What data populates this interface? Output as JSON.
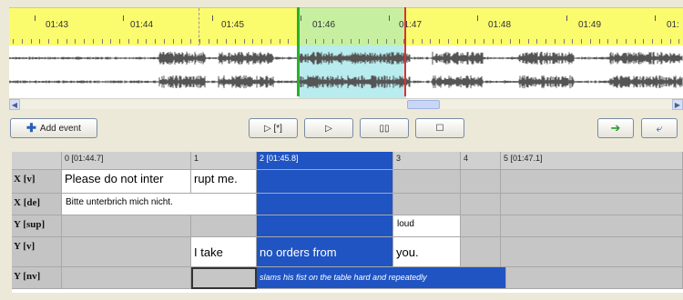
{
  "timeline": {
    "ticks": [
      "01:43",
      "01:44",
      "01:45",
      "01:46",
      "01:47",
      "01:48",
      "01:49",
      "01:"
    ]
  },
  "toolbar": {
    "add_event_label": "Add event",
    "play_selection_label": "▷ [*]",
    "play_label": "▷",
    "pause_label": "▯▯",
    "stop_label": "☐",
    "next_icon": "arrow-right-icon",
    "prev_icon": "arrow-back-icon"
  },
  "grid": {
    "columns": [
      "0 [01:44.7]",
      "1",
      "2 [01:45.8]",
      "3",
      "4",
      "5 [01:47.1]"
    ],
    "rows": [
      {
        "label": "X [v]",
        "cells": [
          "Please do not inter",
          "rupt me.",
          "",
          "",
          "",
          ""
        ]
      },
      {
        "label": "X [de]",
        "cells": [
          "Bitte unterbrich mich nicht.",
          "",
          "",
          "",
          "",
          ""
        ]
      },
      {
        "label": "Y [sup]",
        "cells": [
          "",
          "",
          "",
          "loud",
          "",
          ""
        ]
      },
      {
        "label": "Y [v]",
        "cells": [
          "",
          "I take",
          "no orders from",
          "you.",
          "",
          ""
        ]
      },
      {
        "label": "Y [nv]",
        "cells": [
          "",
          "",
          "slams his fist on the table hard and repeatedly",
          "",
          "",
          ""
        ]
      }
    ]
  },
  "colors": {
    "timeline": "#fbfb6e",
    "selection_timeline": "#c6f0a0",
    "selection_wave": "#b8ecef",
    "selected_cell": "#1f54c2",
    "start_marker": "#2ab02a",
    "end_marker": "#e03030"
  }
}
